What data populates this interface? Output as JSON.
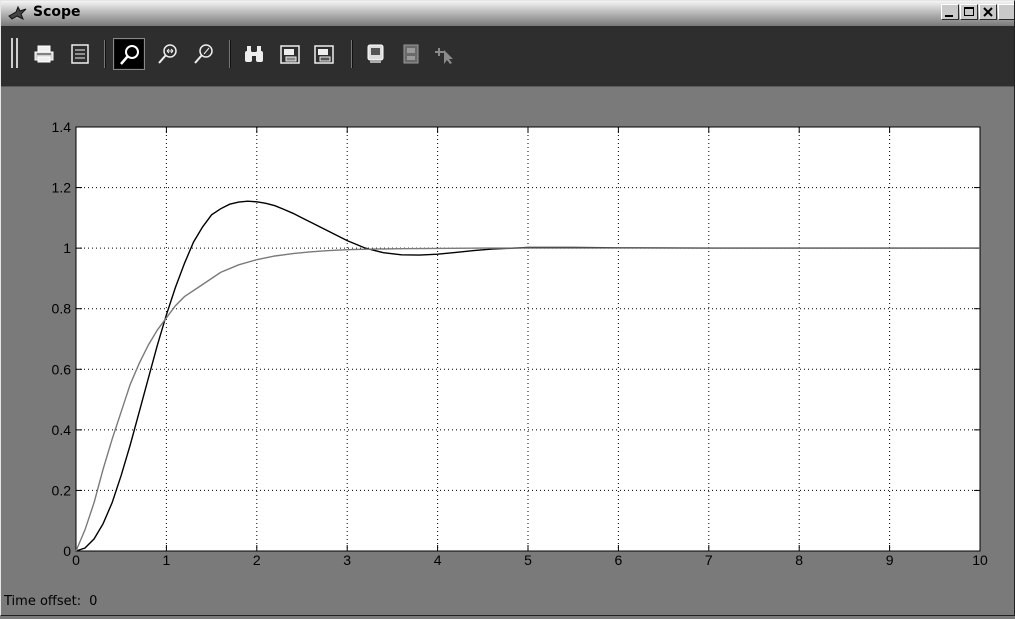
{
  "window": {
    "title": "Scope"
  },
  "toolbar": {
    "buttons": [
      {
        "name": "print-button",
        "icon": "printer-icon"
      },
      {
        "name": "parameters-button",
        "icon": "parameters-icon"
      },
      {
        "name": "zoom-button",
        "icon": "zoom-icon",
        "active": true
      },
      {
        "name": "zoom-x-button",
        "icon": "zoom-x-icon"
      },
      {
        "name": "zoom-y-button",
        "icon": "zoom-y-icon"
      },
      {
        "name": "autoscale-button",
        "icon": "binoculars-icon"
      },
      {
        "name": "save-axes-button",
        "icon": "save-axes-icon"
      },
      {
        "name": "restore-axes-button",
        "icon": "restore-axes-icon"
      },
      {
        "name": "floating-scope-button",
        "icon": "floating-scope-icon"
      },
      {
        "name": "lock-axes-button",
        "icon": "lock-axes-icon",
        "disabled": true
      },
      {
        "name": "signal-selection-button",
        "icon": "signal-selection-icon",
        "disabled": true
      }
    ]
  },
  "status": {
    "time_offset_label": "Time offset:",
    "time_offset_value": "0"
  },
  "chart_data": {
    "type": "line",
    "xlim": [
      0,
      10
    ],
    "ylim": [
      0,
      1.4
    ],
    "x_ticks": [
      "0",
      "1",
      "2",
      "3",
      "4",
      "5",
      "6",
      "7",
      "8",
      "9",
      "10"
    ],
    "y_ticks": [
      "0",
      "0.2",
      "0.4",
      "0.6",
      "0.8",
      "1",
      "1.2",
      "1.4"
    ],
    "grid": true,
    "grid_style": "dotted",
    "series": [
      {
        "color": "#000000",
        "x": [
          0,
          0.1,
          0.2,
          0.3,
          0.4,
          0.5,
          0.6,
          0.7,
          0.8,
          0.9,
          1.0,
          1.1,
          1.2,
          1.3,
          1.4,
          1.5,
          1.6,
          1.7,
          1.8,
          1.9,
          2.0,
          2.1,
          2.2,
          2.3,
          2.4,
          2.5,
          2.6,
          2.8,
          3.0,
          3.2,
          3.4,
          3.6,
          3.8,
          4.0,
          4.2,
          4.4,
          4.6,
          5.0,
          5.5,
          6,
          7,
          8,
          9,
          10
        ],
        "y": [
          0,
          0.01,
          0.04,
          0.09,
          0.16,
          0.25,
          0.35,
          0.46,
          0.57,
          0.68,
          0.78,
          0.87,
          0.95,
          1.02,
          1.07,
          1.11,
          1.13,
          1.145,
          1.152,
          1.155,
          1.153,
          1.148,
          1.14,
          1.128,
          1.115,
          1.1,
          1.085,
          1.055,
          1.025,
          1.0,
          0.985,
          0.978,
          0.977,
          0.98,
          0.986,
          0.992,
          0.997,
          1.002,
          1.002,
          1.001,
          1.0,
          1.0,
          1.0,
          1.0
        ]
      },
      {
        "color": "#7a7a7a",
        "x": [
          0,
          0.1,
          0.2,
          0.3,
          0.4,
          0.5,
          0.6,
          0.7,
          0.8,
          0.9,
          1.0,
          1.1,
          1.2,
          1.4,
          1.6,
          1.8,
          2.0,
          2.2,
          2.4,
          2.6,
          2.8,
          3.0,
          3.3,
          3.6,
          4.0,
          4.5,
          5,
          6,
          7,
          8,
          9,
          10
        ],
        "y": [
          0,
          0.07,
          0.16,
          0.27,
          0.37,
          0.46,
          0.55,
          0.62,
          0.68,
          0.73,
          0.77,
          0.81,
          0.84,
          0.88,
          0.92,
          0.945,
          0.962,
          0.974,
          0.982,
          0.988,
          0.992,
          0.995,
          0.997,
          0.998,
          0.999,
          1.0,
          1.0,
          1.0,
          1.0,
          1.0,
          1.0,
          1.0
        ]
      }
    ]
  }
}
